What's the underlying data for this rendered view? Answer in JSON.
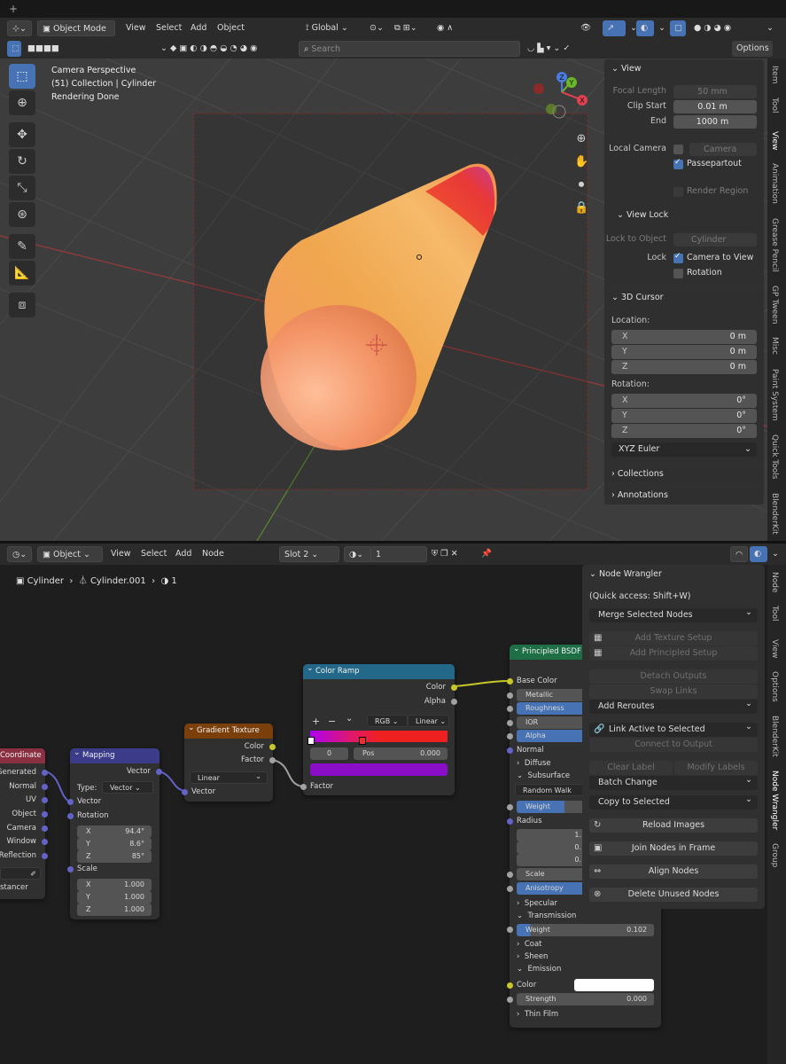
{
  "top_bar": {
    "plus": "+"
  },
  "viewport_header": {
    "mode": "Object Mode",
    "menus": [
      "View",
      "Select",
      "Add",
      "Object"
    ],
    "transform_orientation": "Global",
    "options_label": "Options",
    "search_placeholder": "Search"
  },
  "viewport_info": {
    "line1": "Camera Perspective",
    "line2": "(51) Collection | Cylinder",
    "line3": "Rendering Done"
  },
  "gizmo": {
    "z": "Z",
    "y": "Y",
    "x": "X"
  },
  "n_panel": {
    "view": {
      "title": "View",
      "focal_length_label": "Focal Length",
      "focal_length": "50 mm",
      "clip_start_label": "Clip Start",
      "clip_start": "0.01 m",
      "end_label": "End",
      "end": "1000 m",
      "local_camera_label": "Local Camera",
      "local_camera": "Camera",
      "passepartout_label": "Passepartout",
      "render_region_label": "Render Region",
      "view_lock_title": "View Lock",
      "lock_to_object_label": "Lock to Object",
      "lock_to_object": "Cylinder",
      "lock_label": "Lock",
      "camera_to_view_label": "Camera to View",
      "rotation_label": "Rotation"
    },
    "cursor": {
      "title": "3D Cursor",
      "location_label": "Location:",
      "loc": [
        {
          "k": "X",
          "v": "0 m"
        },
        {
          "k": "Y",
          "v": "0 m"
        },
        {
          "k": "Z",
          "v": "0 m"
        }
      ],
      "rotation_label": "Rotation:",
      "rot": [
        {
          "k": "X",
          "v": "0°"
        },
        {
          "k": "Y",
          "v": "0°"
        },
        {
          "k": "Z",
          "v": "0°"
        }
      ],
      "euler": "XYZ Euler"
    },
    "collections": "Collections",
    "annotations": "Annotations"
  },
  "viewport_tabs": [
    "Item",
    "Tool",
    "View",
    "Animation",
    "Grease Pencil",
    "GP Tween",
    "Misc",
    "Paint System",
    "Quick Tools",
    "BlenderKit"
  ],
  "node_header": {
    "editor_type": "Object",
    "menus": [
      "View",
      "Select",
      "Add",
      "Node"
    ],
    "slot": "Slot 2",
    "material_users": "1"
  },
  "breadcrumb": {
    "object": "Cylinder",
    "mesh": "Cylinder.001",
    "users": "1"
  },
  "node_tabs": [
    "Node",
    "Tool",
    "View",
    "Options",
    "BlenderKit",
    "Node Wrangler",
    "Group"
  ],
  "nodes": {
    "texcoord": {
      "title": "Coordinate",
      "outputs": [
        "Generated",
        "Normal",
        "UV",
        "Object",
        "Camera",
        "Window",
        "Reflection"
      ],
      "footer": "stancer"
    },
    "mapping": {
      "title": "Mapping",
      "out": "Vector",
      "type_label": "Type:",
      "type": "Vector",
      "in_vector": "Vector",
      "rotation": "Rotation",
      "rot": [
        {
          "k": "X",
          "v": "94.4°"
        },
        {
          "k": "Y",
          "v": "8.6°"
        },
        {
          "k": "Z",
          "v": "85°"
        }
      ],
      "scale_label": "Scale",
      "scale": [
        {
          "k": "X",
          "v": "1.000"
        },
        {
          "k": "Y",
          "v": "1.000"
        },
        {
          "k": "Z",
          "v": "1.000"
        }
      ]
    },
    "gradient": {
      "title": "Gradient Texture",
      "out_color": "Color",
      "out_factor": "Factor",
      "type": "Linear",
      "in_vector": "Vector"
    },
    "ramp": {
      "title": "Color Ramp",
      "out_color": "Color",
      "out_alpha": "Alpha",
      "plus": "+",
      "minus": "−",
      "chev": "⌄",
      "mode": "RGB",
      "interp": "Linear",
      "index": "0",
      "pos_label": "Pos",
      "pos": "0.000",
      "in_factor": "Factor"
    },
    "bsdf": {
      "title": "Principled BSDF",
      "base_color": "Base Color",
      "metallic": "Metallic",
      "roughness": "Roughness",
      "ior": "IOR",
      "alpha": "Alpha",
      "normal": "Normal",
      "diffuse": "Diffuse",
      "subsurface": "Subsurface",
      "method": "Random Walk",
      "weight": "Weight",
      "radius": "Radius",
      "radius_vals": [
        "1.",
        "0.",
        "0."
      ],
      "scale": "Scale",
      "anisotropy": "Anisotropy",
      "specular": "Specular",
      "transmission": "Transmission",
      "weight2_label": "Weight",
      "weight2": "0.102",
      "coat": "Coat",
      "sheen": "Sheen",
      "emission": "Emission",
      "color": "Color",
      "strength_label": "Strength",
      "strength": "0.000",
      "thin_film": "Thin Film"
    }
  },
  "node_wrangler": {
    "title": "Node Wrangler",
    "quick_access": "(Quick access: Shift+W)",
    "merge": "Merge Selected Nodes",
    "add_texture_setup": "Add Texture Setup",
    "add_principled_setup": "Add Principled Setup",
    "detach_outputs": "Detach Outputs",
    "swap_links": "Swap Links",
    "add_reroutes": "Add Reroutes",
    "link_active": "Link Active to Selected",
    "connect_output": "Connect to Output",
    "clear_label": "Clear Label",
    "modify_labels": "Modify Labels",
    "batch_change": "Batch Change",
    "copy_selected": "Copy to Selected",
    "reload_images": "Reload Images",
    "join_frame": "Join Nodes in Frame",
    "align_nodes": "Align Nodes",
    "delete_unused": "Delete Unused Nodes"
  },
  "colors": {
    "accent": "#4772b3",
    "vector_socket": "#6363c7",
    "color_socket": "#c7c729",
    "float_socket": "#a1a1a1",
    "shader_header": "#1e6e46",
    "texture_header": "#7a3f0a",
    "converter_header": "#236888",
    "vector_header": "#3b3b8a",
    "input_header": "#8a2f42"
  }
}
